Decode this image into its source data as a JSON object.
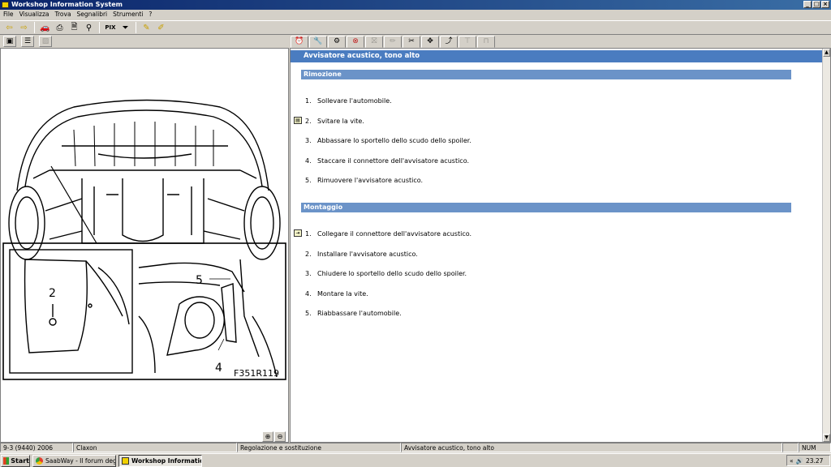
{
  "window": {
    "title": "Workshop Information System",
    "controls": [
      "_",
      "□",
      "×"
    ]
  },
  "menu": [
    "File",
    "Visualizza",
    "Trova",
    "Segnalibri",
    "Strumenti",
    "?"
  ],
  "toolbar": {
    "pix_label": "PIX"
  },
  "document": {
    "title": "Avvisatore acustico, tono alto",
    "removal": {
      "heading": "Rimozione",
      "steps": [
        {
          "n": "1.",
          "text": "Sollevare l'automobile."
        },
        {
          "n": "2.",
          "text": "Svitare la vite."
        },
        {
          "n": "3.",
          "text": "Abbassare lo sportello dello scudo dello spoiler."
        },
        {
          "n": "4.",
          "text": "Staccare il connettore dell'avvisatore acustico."
        },
        {
          "n": "5.",
          "text": "Rimuovere l'avvisatore acustico."
        }
      ]
    },
    "install": {
      "heading": "Montaggio",
      "steps": [
        {
          "n": "1.",
          "text": "Collegare il connettore dell'avvisatore acustico."
        },
        {
          "n": "2.",
          "text": "Installare l'avvisatore acustico."
        },
        {
          "n": "3.",
          "text": "Chiudere lo sportello dello scudo dello spoiler."
        },
        {
          "n": "4.",
          "text": "Montare la vite."
        },
        {
          "n": "5.",
          "text": "Riabbassare l'automobile."
        }
      ]
    }
  },
  "illustration": {
    "code": "F351R119",
    "callout_2": "2",
    "callout_4": "4",
    "callout_5": "5"
  },
  "statusbar": {
    "vehicle": "9-3 (9440) 2006",
    "group": "Claxon",
    "operation": "Regolazione e sostituzione",
    "topic": "Avvisatore acustico, tono alto",
    "num": "NUM"
  },
  "taskbar": {
    "start": "Start",
    "tasks": [
      "SaabWay - Il forum degli...",
      "Workshop Informatio..."
    ],
    "tray_label": "«",
    "clock": "23.27"
  },
  "colors": {
    "title_bar": "#4a7cc0",
    "section_bar": "#6b93c8"
  }
}
